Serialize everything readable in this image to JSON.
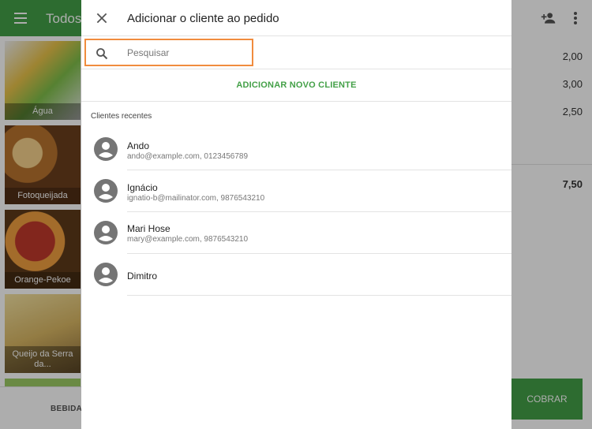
{
  "app": {
    "title": "Todos",
    "products": [
      {
        "label": "Água"
      },
      {
        "label": "Fotoqueijada"
      },
      {
        "label": "Orange-Pekoe"
      },
      {
        "label": "Queijo da Serra da..."
      }
    ],
    "bottom_tab": "BEBIDAS",
    "order_prices": [
      "2,00",
      "3,00",
      "2,50"
    ],
    "order_total": "7,50",
    "charge_label": "COBRAR"
  },
  "dialog": {
    "title": "Adicionar o cliente ao pedido",
    "search_placeholder": "Pesquisar",
    "add_client_label": "ADICIONAR NOVO CLIENTE",
    "recent_label": "Clientes recentes",
    "clients": [
      {
        "name": "Ando",
        "details": "ando@example.com, 0123456789"
      },
      {
        "name": "Ignácio",
        "details": "ignatio-b@mailinator.com, 9876543210"
      },
      {
        "name": "Mari Hose",
        "details": "mary@example.com, 9876543210"
      },
      {
        "name": "Dimitro",
        "details": ""
      }
    ]
  },
  "colors": {
    "brand": "#43a047",
    "search_focus": "#f08c3e"
  },
  "icons": [
    "menu-icon",
    "add-person-icon",
    "more-vert-icon",
    "close-icon",
    "search-icon",
    "account-circle-icon"
  ]
}
